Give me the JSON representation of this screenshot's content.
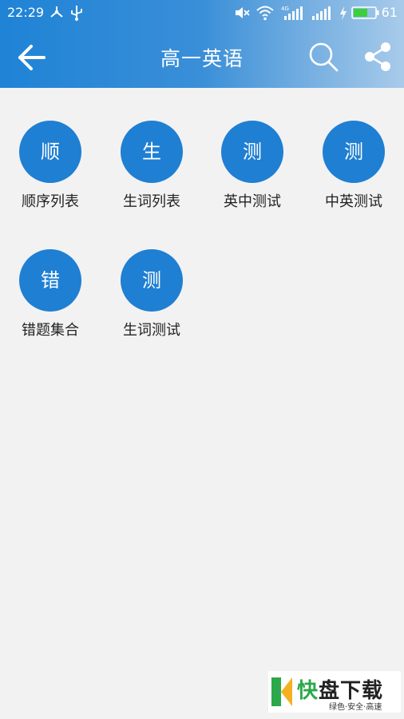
{
  "status_bar": {
    "time": "22:29",
    "battery_level": "61",
    "network": "4G"
  },
  "app_bar": {
    "title": "高一英语",
    "icons": [
      "arrow-left-icon",
      "search-icon",
      "share-icon"
    ]
  },
  "menu": {
    "items": [
      {
        "glyph": "顺",
        "label": "顺序列表"
      },
      {
        "glyph": "生",
        "label": "生词列表"
      },
      {
        "glyph": "测",
        "label": "英中测试"
      },
      {
        "glyph": "测",
        "label": "中英测试"
      },
      {
        "glyph": "错",
        "label": "错题集合"
      },
      {
        "glyph": "测",
        "label": "生词测试"
      }
    ]
  },
  "watermark": {
    "brand_first": "快",
    "brand_rest": "盘下载",
    "tagline": "绿色·安全·高速"
  },
  "colors": {
    "header_start": "#1f83d6",
    "header_end": "#a8cbea",
    "circle": "#1f7fd3",
    "background": "#f2f2f2"
  }
}
